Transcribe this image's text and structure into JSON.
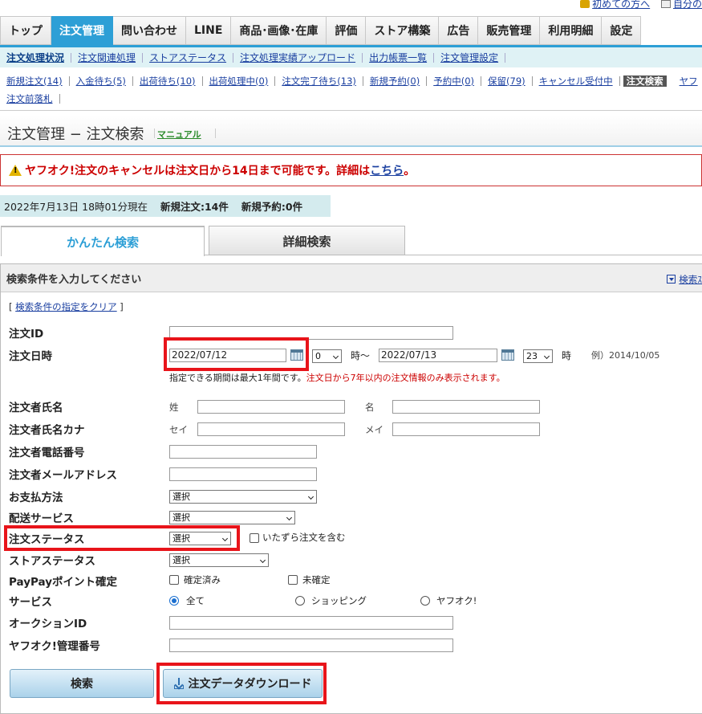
{
  "util": {
    "first_time": "初めての方へ",
    "mine": "自分の"
  },
  "mainnav": [
    "トップ",
    "注文管理",
    "問い合わせ",
    "LINE",
    "商品･画像･在庫",
    "評価",
    "ストア構築",
    "広告",
    "販売管理",
    "利用明細",
    "設定"
  ],
  "subnav": [
    "注文処理状況",
    "注文関連処理",
    "ストアステータス",
    "注文処理実績アップロード",
    "出力帳票一覧",
    "注文管理設定"
  ],
  "status_row1": [
    "新規注文(14)",
    "入金待ち(5)",
    "出荷待ち(10)",
    "出荷処理中(0)",
    "注文完了待ち(13)",
    "新規予約(0)",
    "予約中(0)",
    "保留(79)",
    "キャンセル受付中",
    "注文検索",
    "ヤフ"
  ],
  "status_row2": [
    "注文前落札"
  ],
  "page": {
    "title": "注文管理 − 注文検索",
    "manual": "マニュアル"
  },
  "alert": {
    "text": "ヤフオク!注文のキャンセルは注文日から14日まで可能です。詳細は",
    "link": "こちら",
    "tail": "。"
  },
  "now": {
    "datetime": "2022年7月13日 18時01分現在",
    "new_orders": "新規注文:14件",
    "new_reserve": "新規予約:0件"
  },
  "tabs": {
    "easy": "かんたん検索",
    "detail": "詳細検索"
  },
  "panel": {
    "header": "検索条件を入力してください",
    "header_right": "検索ｽ",
    "clear_open": "[ ",
    "clear_link": "検索条件の指定をクリア",
    "clear_close": " ]"
  },
  "form": {
    "order_id_label": "注文ID",
    "order_date_label": "注文日時",
    "date_from": "2022/07/12",
    "hour_from": "0",
    "hour_sep": "時〜",
    "date_to": "2022/07/13",
    "hour_to": "23",
    "hour_suffix": "時",
    "example": "例）2014/10/05",
    "note_black": "指定できる期間は最大1年間です。",
    "note_red": "注文日から7年以内の注文情報のみ表示されます。",
    "name_label": "注文者氏名",
    "sei": "姓",
    "mei": "名",
    "kana_label": "注文者氏名カナ",
    "sei_kana": "セイ",
    "mei_kana": "メイ",
    "phone_label": "注文者電話番号",
    "mail_label": "注文者メールアドレス",
    "payment_label": "お支払方法",
    "payment_value": "選択",
    "delivery_label": "配送サービス",
    "delivery_value": "選択",
    "order_status_label": "注文ステータス",
    "order_status_value": "選択",
    "prank_label": "いたずら注文を含む",
    "store_status_label": "ストアステータス",
    "store_status_value": "選択",
    "paypay_label": "PayPayポイント確定",
    "confirmed": "確定済み",
    "unconfirmed": "未確定",
    "service_label": "サービス",
    "svc_all": "全て",
    "svc_shopping": "ショッピング",
    "svc_auction": "ヤフオク!",
    "auction_id_label": "オークションID",
    "auction_mgmt_label": "ヤフオク!管理番号"
  },
  "buttons": {
    "search": "検索",
    "download": "注文データダウンロード"
  },
  "colors": {
    "accent": "#2d9fd6",
    "highlight": "#e8141a",
    "alert": "#cc0000"
  }
}
